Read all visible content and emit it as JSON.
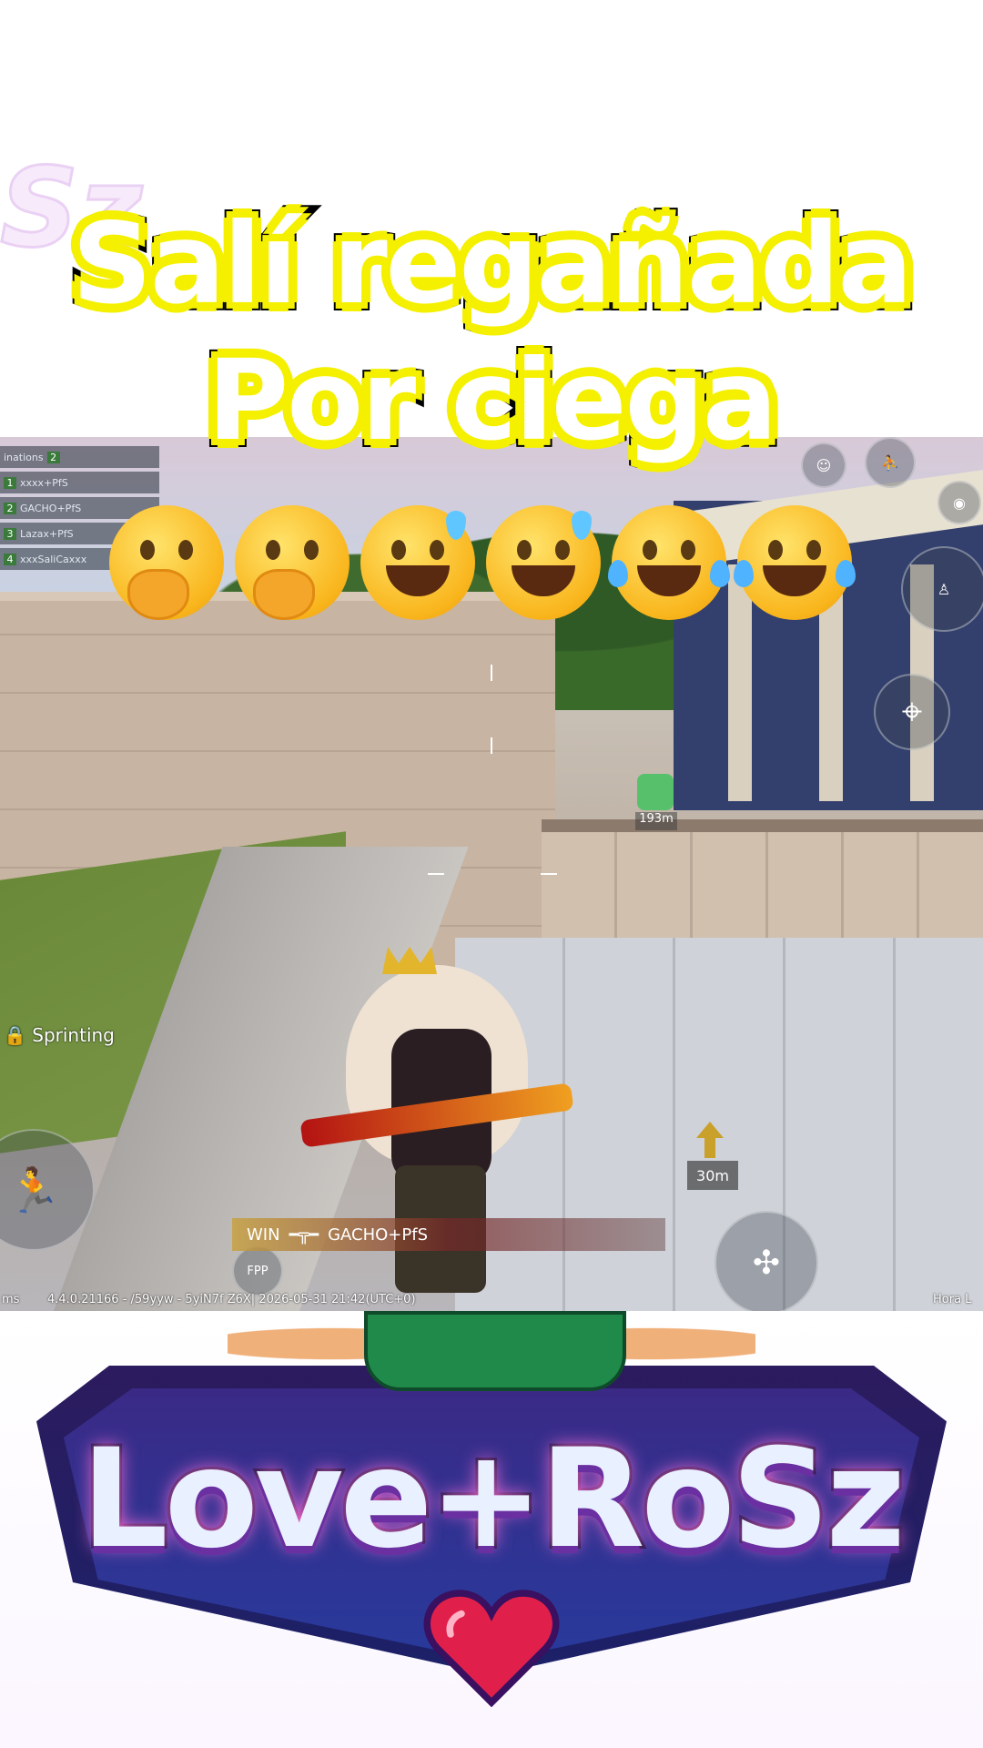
{
  "caption": {
    "line1": "Salí regañada",
    "line2": "Por ciega",
    "emojis": [
      "face-with-hand-over-mouth",
      "face-with-hand-over-mouth",
      "grinning-face-with-sweat",
      "grinning-face-with-sweat",
      "face-with-tears-of-joy",
      "face-with-tears-of-joy"
    ]
  },
  "game_hud": {
    "team_header": "inations",
    "team_count": "2",
    "team_rows": [
      {
        "num": "1",
        "name": "xxxx+PfS"
      },
      {
        "num": "2",
        "name": "GACHO+PfS"
      },
      {
        "num": "3",
        "name": "Lazax+PfS"
      },
      {
        "num": "4",
        "name": "xxxSaliCaxxx"
      }
    ],
    "status_text": "Sprinting",
    "marker_small_distance": "193m",
    "marker_distance": "30m",
    "killfeed": {
      "killer": "WIN",
      "victim": "GACHO+PfS"
    },
    "perspective_button": "FPP",
    "bottom_left": "ms",
    "build_info": "4.4.0.21166 - /59yyw - 5yiN7f Z6X|  2026-05-31 21:42(UTC+0)",
    "bottom_right": "Hora L"
  },
  "logo": {
    "text": "Love+RoSz",
    "colors": {
      "primary": "#e9f0ff",
      "outline": "#1a1440",
      "accent": "#ff6fd8",
      "heart": "#e0204a"
    }
  }
}
